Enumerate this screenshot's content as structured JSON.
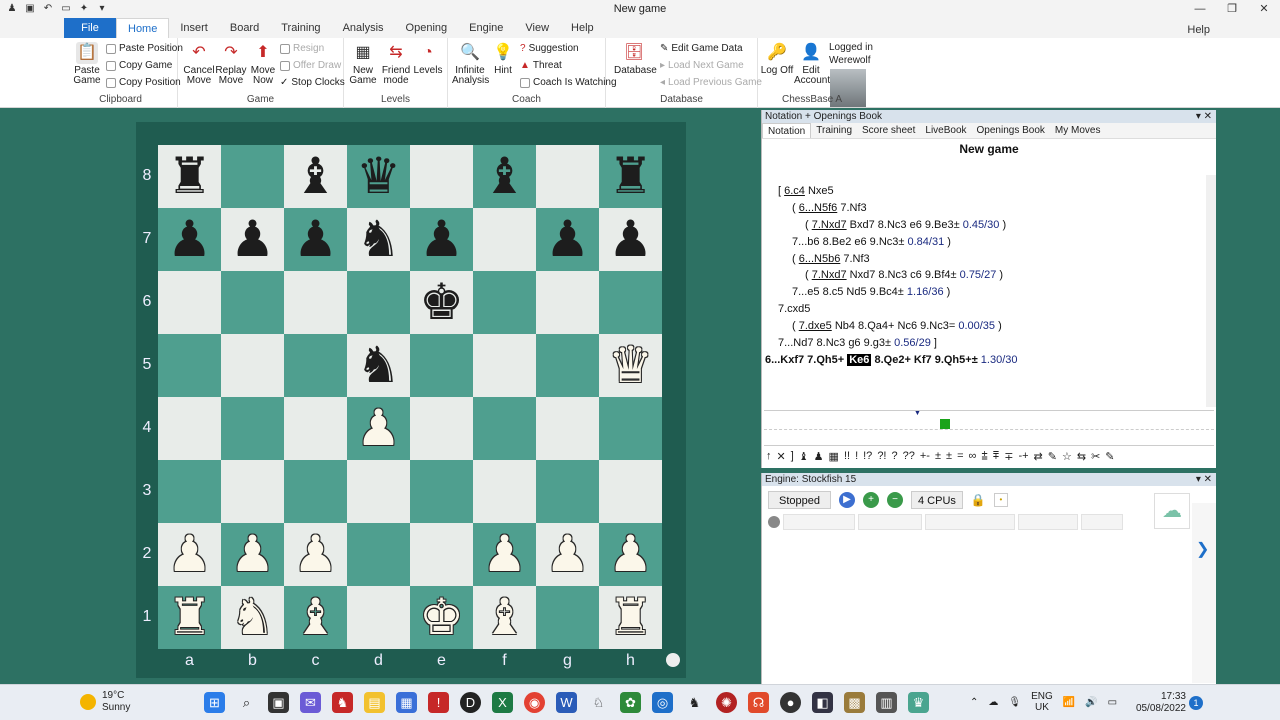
{
  "window": {
    "title": "New game",
    "help": "Help"
  },
  "ribbon_tabs": [
    "File",
    "Home",
    "Insert",
    "Board",
    "Training",
    "Analysis",
    "Opening",
    "Engine",
    "View",
    "Help"
  ],
  "clipboard": {
    "paste_game": "Paste Game",
    "paste_position": "Paste Position",
    "copy_game": "Copy Game",
    "copy_position": "Copy Position",
    "label": "Clipboard"
  },
  "game": {
    "cancel_move": "Cancel Move",
    "replay_move": "Replay Move",
    "move_now": "Move Now",
    "resign": "Resign",
    "offer_draw": "Offer Draw",
    "stop_clocks": "Stop Clocks",
    "label": "Game"
  },
  "levels": {
    "new_game": "New Game",
    "friend_mode": "Friend mode",
    "levels": "Levels",
    "label": "Levels"
  },
  "coach": {
    "infinite_analysis": "Infinite Analysis",
    "hint": "Hint",
    "suggestion": "Suggestion",
    "threat": "Threat",
    "coach_watching": "Coach Is Watching",
    "label": "Coach"
  },
  "database": {
    "database": "Database",
    "edit_game_data": "Edit Game Data",
    "load_next_game": "Load Next Game",
    "load_previous_game": "Load Previous Game",
    "label": "Database"
  },
  "account": {
    "log_off": "Log Off",
    "edit_account": "Edit Account",
    "logged_in": "Logged in",
    "user": "Werewolf",
    "label": "ChessBase A"
  },
  "board": {
    "ranks": [
      "8",
      "7",
      "6",
      "5",
      "4",
      "3",
      "2",
      "1"
    ],
    "files": [
      "a",
      "b",
      "c",
      "d",
      "e",
      "f",
      "g",
      "h"
    ],
    "rows": [
      [
        "br",
        "",
        "bb",
        "bq",
        "",
        "bb",
        "",
        "br"
      ],
      [
        "bp",
        "bp",
        "bp",
        "bn",
        "bp",
        "",
        "bp",
        "bp"
      ],
      [
        "",
        "",
        "",
        "",
        "bk",
        "",
        "",
        ""
      ],
      [
        "",
        "",
        "",
        "bn",
        "",
        "",
        "",
        "wq"
      ],
      [
        "",
        "",
        "",
        "wp",
        "",
        "",
        "",
        ""
      ],
      [
        "",
        "",
        "",
        "",
        "",
        "",
        "",
        ""
      ],
      [
        "wp",
        "wp",
        "wp",
        "",
        "",
        "wp",
        "wp",
        "wp"
      ],
      [
        "wr",
        "wn",
        "wb",
        "",
        "wk",
        "wb",
        "",
        "wr"
      ]
    ]
  },
  "notation": {
    "panel_title": "Notation + Openings Book",
    "tabs": [
      "Notation",
      "Training",
      "Score sheet",
      "LiveBook",
      "Openings Book",
      "My Moves"
    ],
    "game_title": "New game",
    "l1a": "[ ",
    "l1b": "6.c4",
    "l1c": "  Nxe5",
    "l2a": "( ",
    "l2b": "6...N5f6",
    "l2c": "  7.Nf3",
    "l3a": "( ",
    "l3b": "7.Nxd7",
    "l3c": "  Bxd7  8.Nc3  e6  9.Be3± ",
    "l3d": "0.45/30",
    "l3e": " )",
    "l4a": "7...b6  8.Be2  e6  9.Nc3± ",
    "l4b": "0.84/31",
    "l4c": " )",
    "l5a": "( ",
    "l5b": "6...N5b6",
    "l5c": "  7.Nf3",
    "l6a": "( ",
    "l6b": "7.Nxd7",
    "l6c": "  Nxd7  8.Nc3  c6  9.Bf4± ",
    "l6d": "0.75/27",
    "l6e": " )",
    "l7a": "7...e5  8.c5  Nd5  9.Bc4± ",
    "l7b": "1.16/36",
    "l7c": " )",
    "l8a": "7.cxd5",
    "l9a": "( ",
    "l9b": "7.dxe5",
    "l9c": "  Nb4  8.Qa4+  Nc6  9.Nc3= ",
    "l9d": "0.00/35",
    "l9e": " )",
    "l10a": "7...Nd7  8.Nc3  g6  9.g3± ",
    "l10b": "0.56/29",
    "l10c": " ]",
    "m1": "6...Kxf7  7.Qh5+ ",
    "m2": "Ke6",
    "m3": " 8.Qe2+  Kf7  9.Qh5+± ",
    "m4": "1.30/30",
    "symbols": [
      "↑",
      "✕",
      "]",
      "♝",
      "♟",
      "▦",
      "!!",
      "!",
      "!?",
      "?!",
      "?",
      "??",
      "+-",
      "±",
      "±",
      "=",
      "∞",
      "⩲",
      "⩱",
      "∓",
      "-+",
      "⇄",
      "✎",
      "☆",
      "⇆",
      "✂",
      "✎"
    ]
  },
  "engine": {
    "panel_title": "Engine: Stockfish 15",
    "stopped": "Stopped",
    "cpus": "4 CPUs"
  },
  "taskbar": {
    "temp": "19°C",
    "weather": "Sunny",
    "lang1": "ENG",
    "lang2": "UK",
    "time": "17:33",
    "date": "05/08/2022",
    "notif": "1"
  },
  "colors": {
    "accent": "#1e6fc9",
    "board_dark": "#4f9f8f",
    "board_light": "#e8ece9",
    "background": "#2d7163"
  }
}
